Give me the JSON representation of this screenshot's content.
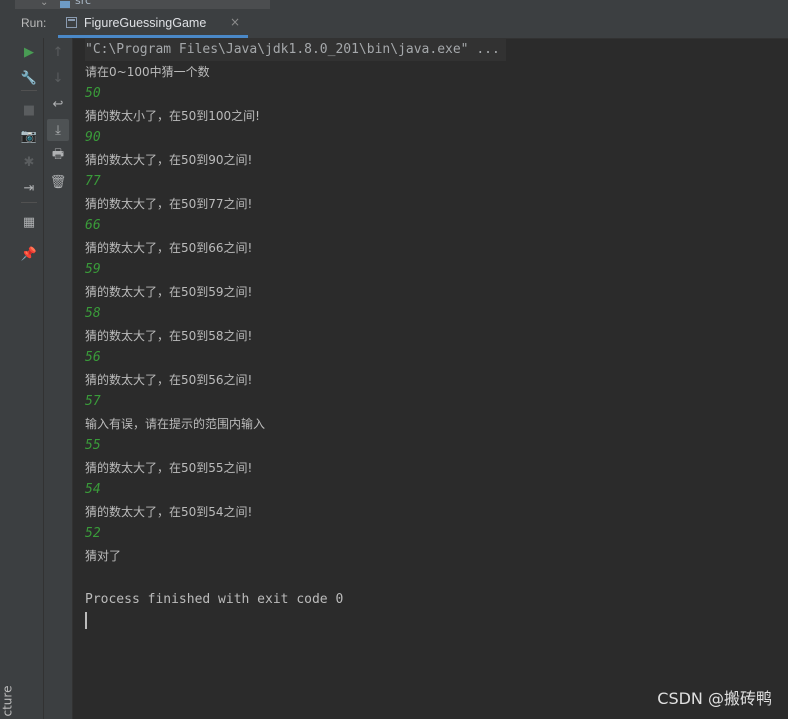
{
  "window": {
    "structure_label": "cture",
    "project_tree_partial": "src"
  },
  "run_panel": {
    "label": "Run:",
    "tab": {
      "title": "FigureGuessingGame",
      "close": "×"
    }
  },
  "toolbar_primary": [
    {
      "name": "rerun-icon",
      "glyph": "▶",
      "color": "#499c54"
    },
    {
      "name": "wrench-icon",
      "glyph": "🔧",
      "color": "#afb1b3"
    },
    {
      "name": "stop-icon",
      "glyph": "■",
      "color": "#5a5d5f"
    },
    {
      "name": "camera-icon",
      "glyph": "📷",
      "color": "#5a5d5f"
    },
    {
      "name": "bug-icon",
      "glyph": "✱",
      "color": "#5a5d5f"
    },
    {
      "name": "exit-icon",
      "glyph": "⇥",
      "color": "#afb1b3"
    },
    {
      "name": "layout-icon",
      "glyph": "▦",
      "color": "#afb1b3"
    },
    {
      "name": "pin-icon",
      "glyph": "📌",
      "color": "#afb1b3"
    }
  ],
  "toolbar_secondary": [
    {
      "name": "arrow-up-icon",
      "glyph": "↑",
      "color": "#5a5d5f"
    },
    {
      "name": "arrow-down-icon",
      "glyph": "↓",
      "color": "#5a5d5f"
    },
    {
      "name": "soft-wrap-icon",
      "glyph": "↩",
      "color": "#afb1b3"
    },
    {
      "name": "scroll-to-end-icon",
      "glyph": "⤓",
      "color": "#afb1b3"
    },
    {
      "name": "print-icon",
      "glyph": "🖶",
      "color": "#afb1b3"
    },
    {
      "name": "trash-icon",
      "glyph": "🗑",
      "color": "#afb1b3"
    }
  ],
  "console": {
    "lines": [
      {
        "type": "cmd",
        "text": "\"C:\\Program Files\\Java\\jdk1.8.0_201\\bin\\java.exe\" ..."
      },
      {
        "type": "out",
        "text": "请在0~100中猜一个数"
      },
      {
        "type": "user",
        "text": "50"
      },
      {
        "type": "out",
        "text": "猜的数太小了，在50到100之间!"
      },
      {
        "type": "user",
        "text": "90"
      },
      {
        "type": "out",
        "text": "猜的数太大了，在50到90之间!"
      },
      {
        "type": "user",
        "text": "77"
      },
      {
        "type": "out",
        "text": "猜的数太大了，在50到77之间!"
      },
      {
        "type": "user",
        "text": "66"
      },
      {
        "type": "out",
        "text": "猜的数太大了，在50到66之间!"
      },
      {
        "type": "user",
        "text": "59"
      },
      {
        "type": "out",
        "text": "猜的数太大了，在50到59之间!"
      },
      {
        "type": "user",
        "text": "58"
      },
      {
        "type": "out",
        "text": "猜的数太大了，在50到58之间!"
      },
      {
        "type": "user",
        "text": "56"
      },
      {
        "type": "out",
        "text": "猜的数太大了，在50到56之间!"
      },
      {
        "type": "user",
        "text": "57"
      },
      {
        "type": "out",
        "text": "输入有误，请在提示的范围内输入"
      },
      {
        "type": "user",
        "text": "55"
      },
      {
        "type": "out",
        "text": "猜的数太大了，在50到55之间!"
      },
      {
        "type": "user",
        "text": "54"
      },
      {
        "type": "out",
        "text": "猜的数太大了，在50到54之间!"
      },
      {
        "type": "user",
        "text": "52"
      },
      {
        "type": "out",
        "text": "猜对了"
      },
      {
        "type": "blank",
        "text": ""
      },
      {
        "type": "sys",
        "text": "Process finished with exit code 0"
      }
    ],
    "colors": {
      "user_input": "#3a9b3a",
      "output": "#bbbbbb",
      "command": "#a5a8ab"
    }
  },
  "watermark": "CSDN @搬砖鸭"
}
